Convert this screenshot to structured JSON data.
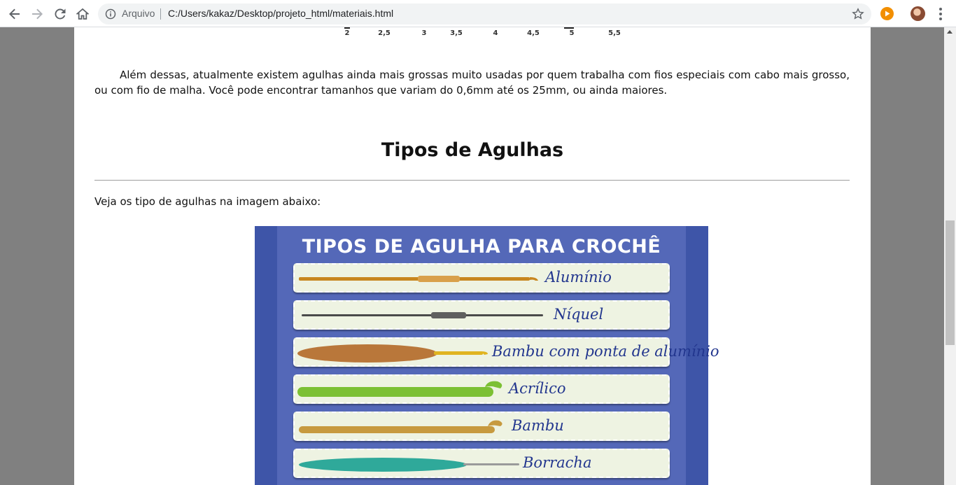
{
  "browser": {
    "scheme_label": "Arquivo",
    "url": "C:/Users/kakaz/Desktop/projeto_html/materiais.html"
  },
  "ruler": {
    "labels": [
      "2",
      "2,5",
      "3",
      "3,5",
      "4",
      "4,5",
      "5",
      "5,5"
    ]
  },
  "content": {
    "paragraph": "Além dessas, atualmente existem agulhas ainda mais grossas muito usadas por quem trabalha com fios especiais com cabo mais grosso, ou com fio de malha. Você pode encontrar tamanhos que variam do 0,6mm até os 25mm, ou ainda maiores.",
    "heading": "Tipos de Agulhas",
    "intro": "Veja os tipo de agulhas na imagem abaixo:"
  },
  "figure": {
    "title": "TIPOS DE AGULHA PARA CROCHÊ",
    "items": [
      {
        "label": "Alumínio",
        "color": "#c8861f"
      },
      {
        "label": "Níquel",
        "color": "#4a4a4a"
      },
      {
        "label": "Bambu com ponta de alumínio",
        "color": "#b9773a"
      },
      {
        "label": "Acrílico",
        "color": "#7cc034"
      },
      {
        "label": "Bambu",
        "color": "#c79a3f"
      },
      {
        "label": "Borracha",
        "color": "#2fa99a"
      }
    ]
  },
  "colors": {
    "figure_bg": "#3e55a8",
    "label_text": "#22368e"
  }
}
